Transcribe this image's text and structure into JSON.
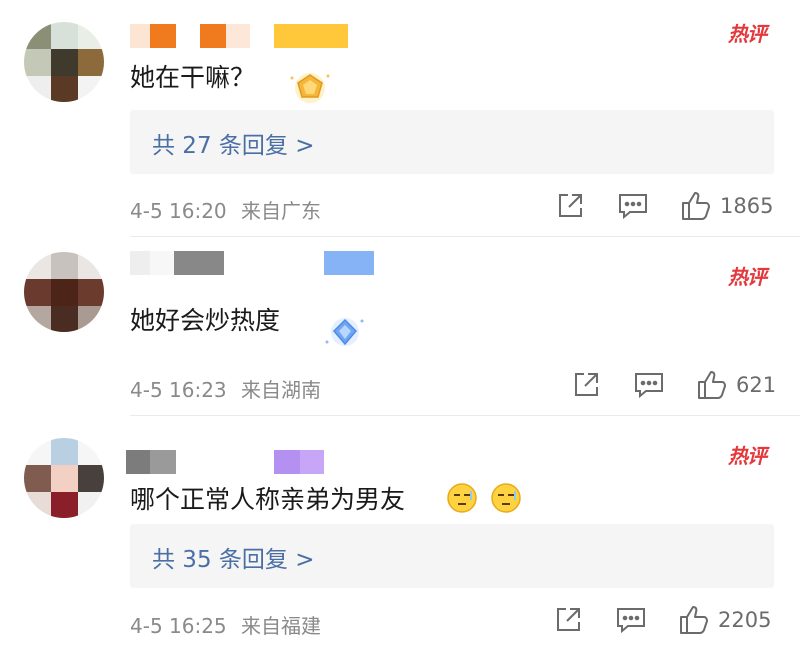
{
  "comments": [
    {
      "badge": "热评",
      "text": "她在干嘛？",
      "replies": "共 27 条回复 >",
      "time": "4-5 16:20",
      "location": "来自广东",
      "likes": "1865"
    },
    {
      "badge": "热评",
      "text": "她好会炒热度",
      "replies": "",
      "time": "4-5 16:23",
      "location": "来自湖南",
      "likes": "621"
    },
    {
      "badge": "热评",
      "text": "哪个正常人称亲弟为男友",
      "replies": "共 35 条回复 >",
      "time": "4-5 16:25",
      "location": "来自福建",
      "likes": "2205"
    }
  ],
  "icons": [
    "share-icon",
    "comment-icon",
    "like-icon",
    "badge-icon",
    "emoji-icon"
  ],
  "colors": {
    "hot": "#e4393c",
    "reply_link": "#4a6fa5",
    "meta": "#8a8a8a",
    "reply_bg": "#f5f5f5"
  }
}
